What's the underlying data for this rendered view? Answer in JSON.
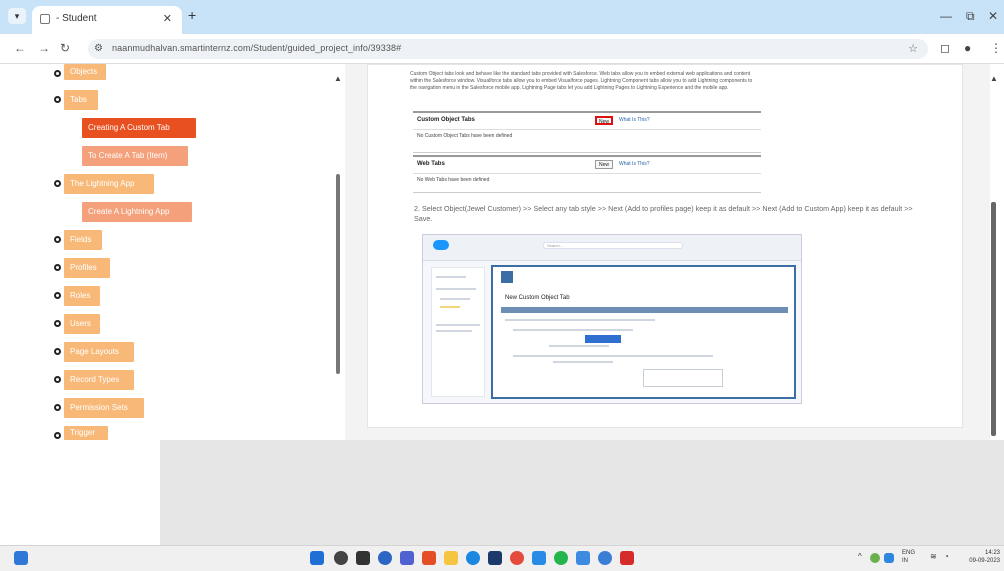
{
  "browser": {
    "tab_title": "- Student",
    "url": "naanmudhalvan.smartinternz.com/Student/guided_project_info/39338#"
  },
  "sidebar": {
    "items": [
      {
        "label": "Objects",
        "type": "topic"
      },
      {
        "label": "Tabs",
        "type": "topic"
      },
      {
        "label": "Creating A Custom Tab",
        "type": "active-sub"
      },
      {
        "label": "To Create A Tab (Item)",
        "type": "sub"
      },
      {
        "label": "The Lightning App",
        "type": "topic"
      },
      {
        "label": "Create A Lightning App",
        "type": "sub"
      },
      {
        "label": "Fields",
        "type": "topic"
      },
      {
        "label": "Profiles",
        "type": "topic"
      },
      {
        "label": "Roles",
        "type": "topic"
      },
      {
        "label": "Users",
        "type": "topic"
      },
      {
        "label": "Page Layouts",
        "type": "topic"
      },
      {
        "label": "Record Types",
        "type": "topic"
      },
      {
        "label": "Permission Sets",
        "type": "topic"
      },
      {
        "label": "Trigger",
        "type": "topic"
      }
    ]
  },
  "doc": {
    "intro": "Custom Object tabs look and behave like the standard tabs provided with Salesforce. Web tabs allow you to embed external web applications and content within the Salesforce window. Visualforce tabs allow you to embed Visualforce pages. Lightning Component tabs allow you to add Lightning components to the navigation menu in the Salesforce mobile app. Lightning Page tabs let you add Lightning Pages to Lightning Experience and the mobile app.",
    "custom_tabs": {
      "heading": "Custom Object Tabs",
      "new_label": "New",
      "what_label": "What Is This?",
      "empty": "No Custom Object Tabs have been defined"
    },
    "web_tabs": {
      "heading": "Web Tabs",
      "new_label": "New",
      "what_label": "What Is This?",
      "empty": "No Web Tabs have been defined"
    },
    "step2": "2. Select Object(Jewel Customer) >> Select any tab style >> Next (Add to profiles page) keep it as default >> Next (Add to Custom App) keep it as default >> Save.",
    "screenshot": {
      "title": "New Custom Object Tab",
      "search_placeholder": "Search..."
    }
  },
  "taskbar": {
    "lang": "ENG",
    "region": "IN",
    "time": "14:23",
    "date": "09-09-2023"
  },
  "colors": {
    "tab_active": "#e8501f",
    "tab_item": "#f4a07a",
    "topic": "#f8b978",
    "chrome": "#c8e2f7"
  }
}
